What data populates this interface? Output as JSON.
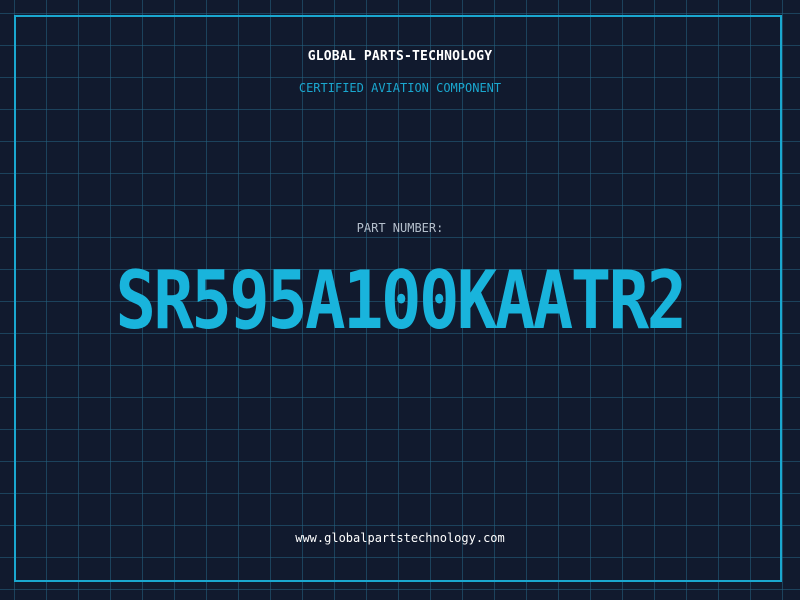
{
  "header": {
    "company": "GLOBAL PARTS-TECHNOLOGY",
    "tagline": "CERTIFIED AVIATION COMPONENT"
  },
  "part": {
    "label": "PART NUMBER:",
    "number": "SR595A100KAATR2"
  },
  "footer": {
    "website": "www.globalpartstechnology.com"
  },
  "colors": {
    "background": "#111a2e",
    "grid": "#256382",
    "accent": "#1aa7cf",
    "part_number": "#19b4dc",
    "text": "#ffffff"
  }
}
